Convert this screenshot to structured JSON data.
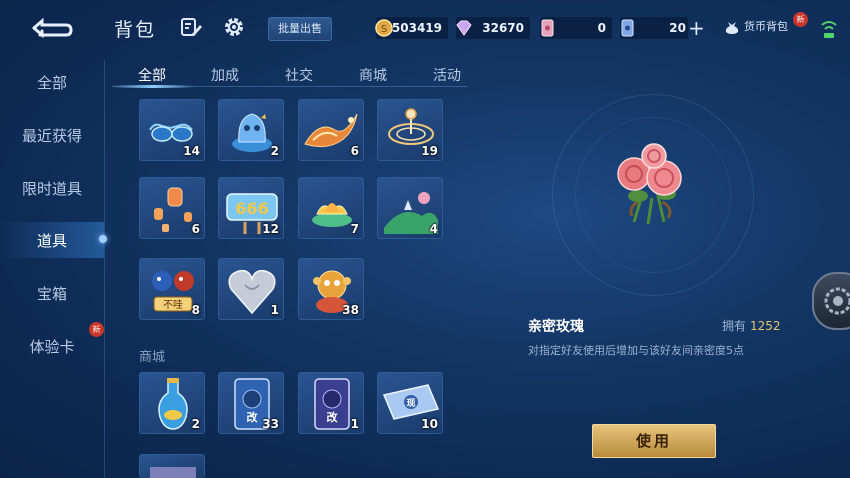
{
  "header": {
    "title": "背包",
    "bulk_sell_label": "批量出售",
    "currencies": [
      {
        "icon": "gold-coin-icon",
        "value": "503419"
      },
      {
        "icon": "diamond-icon",
        "value": "32670"
      },
      {
        "icon": "voucher-card-icon",
        "value": "0"
      },
      {
        "icon": "ticket-card-icon",
        "value": "20"
      }
    ],
    "plus_label": "+",
    "wallet_label": "货币背包",
    "wallet_badge": "新"
  },
  "sidebar": {
    "items": [
      {
        "label": "全部"
      },
      {
        "label": "最近获得"
      },
      {
        "label": "限时道具"
      },
      {
        "label": "道具",
        "active": true
      },
      {
        "label": "宝箱"
      },
      {
        "label": "体验卡",
        "badge": "新"
      }
    ]
  },
  "tabs": [
    {
      "label": "全部",
      "active": true
    },
    {
      "label": "加成"
    },
    {
      "label": "社交"
    },
    {
      "label": "商城"
    },
    {
      "label": "活动"
    }
  ],
  "items": [
    {
      "icon": "sunglasses-icon",
      "qty": "14"
    },
    {
      "icon": "blue-creature-icon",
      "qty": "2"
    },
    {
      "icon": "fire-dragon-icon",
      "qty": "6"
    },
    {
      "icon": "golden-swirl-icon",
      "qty": "19"
    },
    {
      "icon": "sky-lantern-icon",
      "qty": "6"
    },
    {
      "icon": "666-sign-icon",
      "qty": "12"
    },
    {
      "icon": "lotus-lamp-icon",
      "qty": "7"
    },
    {
      "icon": "green-hill-icon",
      "qty": "4"
    },
    {
      "icon": "twin-birds-icon",
      "qty": "8",
      "sign_text": "不哇"
    },
    {
      "icon": "silver-heart-icon",
      "qty": "1"
    },
    {
      "icon": "monkey-mascot-icon",
      "qty": "38"
    }
  ],
  "shop_section": {
    "title": "商城",
    "items": [
      {
        "icon": "potion-bottle-icon",
        "qty": "2"
      },
      {
        "icon": "rename-card-icon",
        "qty": "33",
        "card_text": "改"
      },
      {
        "icon": "rename-card-icon",
        "qty": "1",
        "card_text": "改"
      },
      {
        "icon": "voucher-ticket-icon",
        "qty": "10",
        "card_text": "现"
      }
    ]
  },
  "detail": {
    "name": "亲密玫瑰",
    "owned_label": "拥有",
    "owned_count": "1252",
    "description": "对指定好友使用后增加与该好友间亲密度5点",
    "use_label": "使用"
  }
}
